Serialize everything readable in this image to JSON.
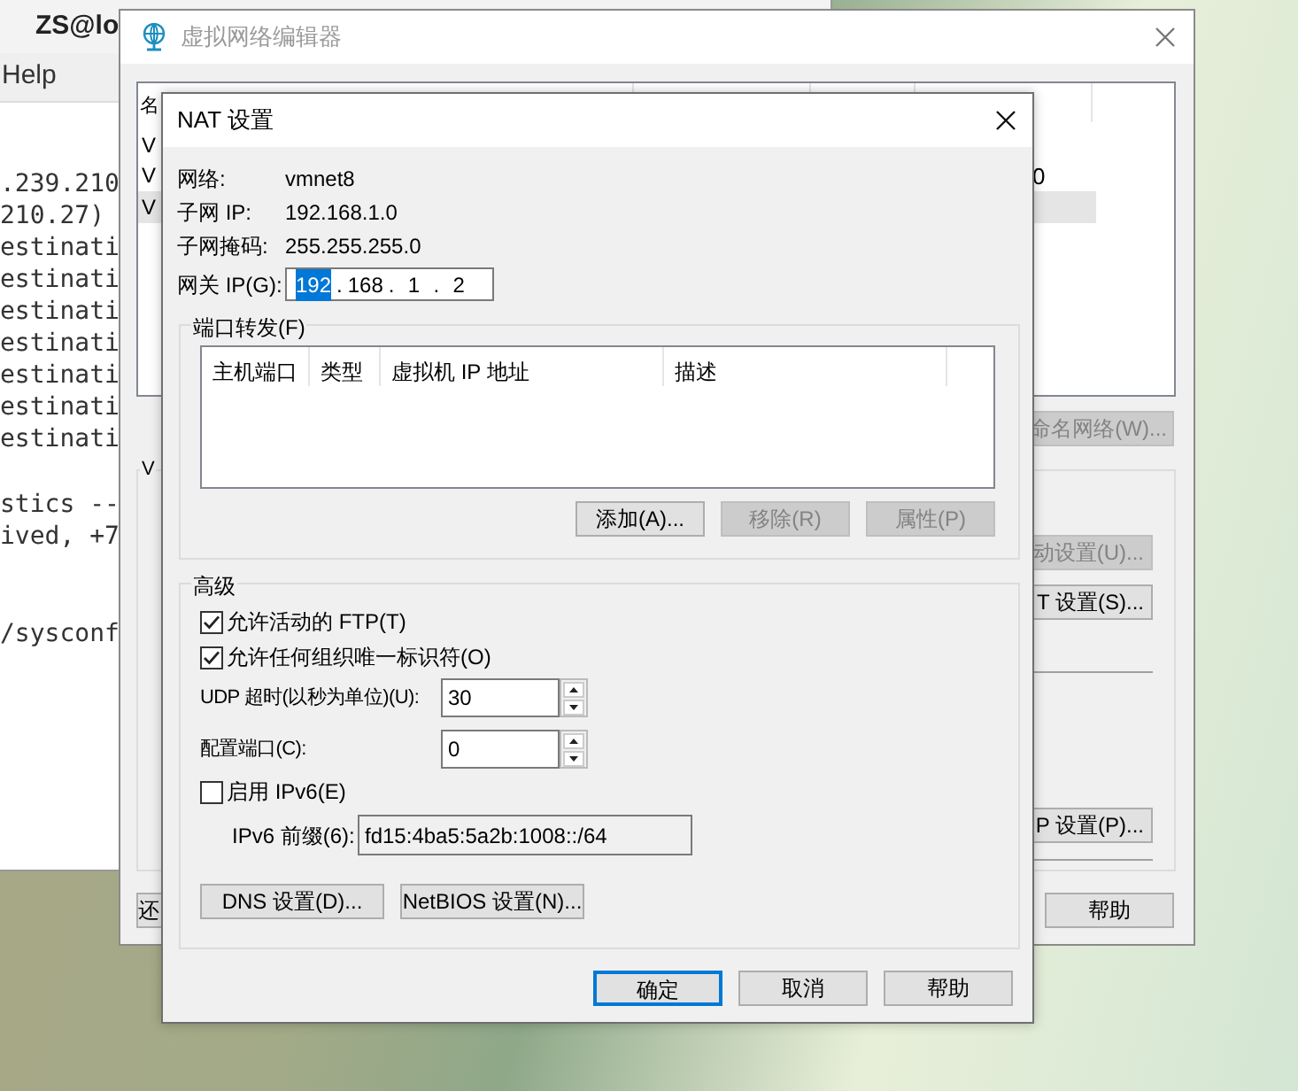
{
  "terminal": {
    "title": "ZS@lo",
    "menu": [
      {
        "label": "Help"
      }
    ],
    "blocks": [
      [
        ".239.210",
        "210.27)",
        "estinati",
        "estinati",
        "estinati",
        "estinati",
        "estinati",
        "estinati",
        "estinati"
      ],
      [
        "stics --",
        "ived, +7"
      ],
      [
        "/sysconf"
      ]
    ]
  },
  "editor": {
    "title": "虚拟网络编辑器",
    "list": {
      "header": "名",
      "rows": [
        {
          "name": "V",
          "selected": false
        },
        {
          "name": "V",
          "value": "0",
          "selected": false
        },
        {
          "name": "V",
          "selected": true
        }
      ]
    },
    "rename_button": {
      "label": "命名网络(W)...",
      "disabled": true
    },
    "group": {
      "label": "V",
      "buttons": [
        {
          "label": "动设置(U)...",
          "disabled": true
        },
        {
          "label": "T 设置(S)...",
          "disabled": false
        },
        {
          "label": "P 设置(P)...",
          "disabled": false
        }
      ]
    },
    "footer_buttons": [
      {
        "label": "还"
      },
      {
        "label": "帮助"
      }
    ]
  },
  "nat": {
    "title": "NAT 设置",
    "info": [
      {
        "label": "网络:",
        "value": "vmnet8"
      },
      {
        "label": "子网 IP:",
        "value": "192.168.1.0"
      },
      {
        "label": "子网掩码:",
        "value": "255.255.255.0"
      }
    ],
    "gateway": {
      "label": "网关 IP(G):",
      "separator": ".",
      "octets": [
        {
          "text": "192",
          "selected": true
        },
        {
          "text": "168",
          "selected": false
        },
        {
          "text": "1",
          "selected": false
        },
        {
          "text": "2",
          "selected": false
        }
      ]
    },
    "port_forwarding": {
      "label": "端口转发(F)",
      "columns": [
        "主机端口",
        "类型",
        "虚拟机 IP 地址",
        "描述"
      ],
      "buttons": [
        {
          "label": "添加(A)...",
          "disabled": false
        },
        {
          "label": "移除(R)",
          "disabled": true
        },
        {
          "label": "属性(P)",
          "disabled": true
        }
      ]
    },
    "advanced": {
      "label": "高级",
      "options": [
        {
          "kind": "checkbox",
          "label": "允许活动的 FTP(T)",
          "checked": true
        },
        {
          "kind": "checkbox",
          "label": "允许任何组织唯一标识符(O)",
          "checked": true
        },
        {
          "kind": "spin",
          "label": "UDP 超时(以秒为单位)(U):",
          "value": "30"
        },
        {
          "kind": "spin",
          "label": "配置端口(C):",
          "value": "0"
        },
        {
          "kind": "checkbox",
          "label": "启用 IPv6(E)",
          "checked": false
        },
        {
          "kind": "text",
          "label": "IPv6 前缀(6):",
          "value": "fd15:4ba5:5a2b:1008::/64",
          "disabled": true
        }
      ],
      "buttons": [
        {
          "label": "DNS 设置(D)..."
        },
        {
          "label": "NetBIOS 设置(N)..."
        }
      ]
    },
    "buttons": [
      {
        "label": "确定",
        "default": true
      },
      {
        "label": "取消",
        "default": false
      },
      {
        "label": "帮助",
        "default": false
      }
    ]
  }
}
